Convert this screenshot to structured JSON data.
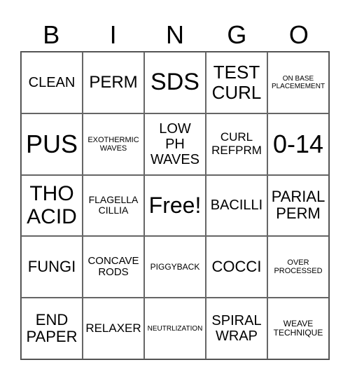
{
  "header": [
    "B",
    "I",
    "N",
    "G",
    "O"
  ],
  "cells": [
    [
      "CLEAN",
      "PERM",
      "SDS",
      "TEST\nCURL",
      "ON BASE\nPLACEMEMENT"
    ],
    [
      "PUS",
      "EXOTHERMIC\nWAVES",
      "LOW\nPH\nWAVES",
      "CURL\nREFPRM",
      "0-14"
    ],
    [
      "THO\nACID",
      "FLAGELLA\nCILLIA",
      "Free!",
      "BACILLI",
      "PARIAL\nPERM"
    ],
    [
      "FUNGI",
      "CONCAVE\nRODS",
      "PIGGYBACK",
      "COCCI",
      "OVER\nPROCESSED"
    ],
    [
      "END\nPAPER",
      "RELAXER",
      "NEUTRLIZATION",
      "SPIRAL\nWRAP",
      "WEAVE\nTECHNIQUE"
    ]
  ]
}
